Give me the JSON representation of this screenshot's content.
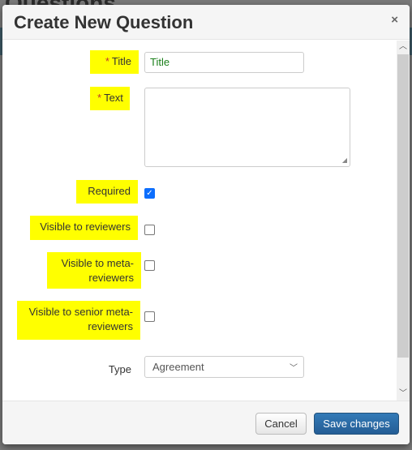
{
  "background": {
    "page_title": "Questions"
  },
  "modal": {
    "title": "Create New Question",
    "close_label": "×",
    "fields": {
      "title": {
        "label": "Title",
        "required_mark": "*",
        "value": "Title"
      },
      "text": {
        "label": "Text",
        "required_mark": "*",
        "value": ""
      },
      "required": {
        "label": "Required",
        "checked": true
      },
      "visible_reviewers": {
        "label": "Visible to reviewers",
        "checked": false
      },
      "visible_meta": {
        "label_line1": "Visible to meta-",
        "label_line2": "reviewers",
        "checked": false
      },
      "visible_senior": {
        "label_line1": "Visible to senior meta-",
        "label_line2": "reviewers",
        "checked": false
      },
      "type": {
        "label": "Type",
        "value": "Agreement"
      }
    },
    "footer": {
      "cancel_label": "Cancel",
      "save_label": "Save changes"
    }
  },
  "colors": {
    "highlight": "#ffff00",
    "primary": "#337ab7",
    "value_text": "#1a7f1a"
  }
}
